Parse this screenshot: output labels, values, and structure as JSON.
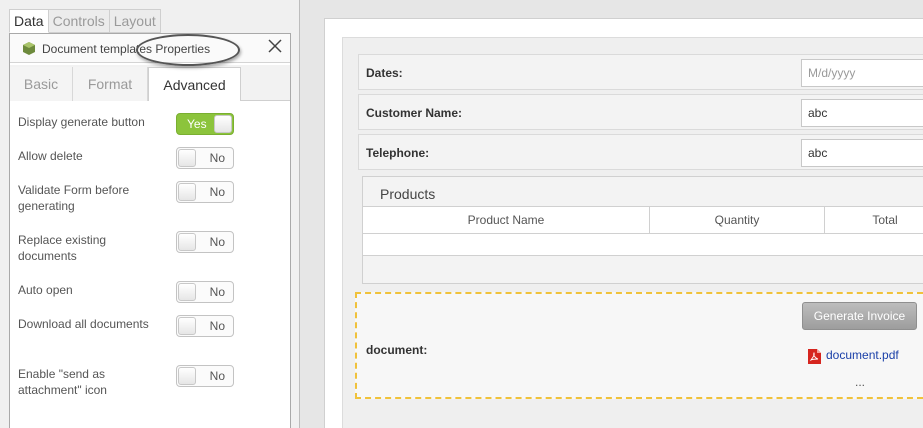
{
  "top_tabs": [
    "Data",
    "Controls",
    "Layout"
  ],
  "props_window": {
    "title": "Document templates Properties",
    "sub_tabs": [
      "Basic",
      "Format",
      "Advanced"
    ]
  },
  "properties": [
    {
      "label": "Display generate button",
      "toggle": "Yes",
      "on": true
    },
    {
      "label": "Allow delete",
      "toggle": "No",
      "on": false
    },
    {
      "label": "Validate Form before generating",
      "toggle": "No",
      "on": false
    },
    {
      "label": "Replace existing documents",
      "toggle": "No",
      "on": false
    },
    {
      "label": "Auto open",
      "toggle": "No",
      "on": false
    },
    {
      "label": "Download all documents",
      "toggle": "No",
      "on": false
    },
    {
      "label": "Enable \"send as attachment\" icon",
      "toggle": "No",
      "on": false
    }
  ],
  "form": {
    "fields": [
      {
        "label": "Dates:",
        "value": "",
        "placeholder": "M/d/yyyy"
      },
      {
        "label": "Customer Name:",
        "value": "abc",
        "placeholder": ""
      },
      {
        "label": "Telephone:",
        "value": "abc",
        "placeholder": ""
      }
    ],
    "products": {
      "title": "Products",
      "columns": [
        "Product Name",
        "Quantity",
        "Total"
      ]
    },
    "document": {
      "label": "document:",
      "button": "Generate Invoice",
      "file": "document.pdf",
      "more": "..."
    }
  },
  "colors": {
    "toggle_on": "#8cc43c",
    "link": "#1a3fa8",
    "highlight_border": "#f0c23b"
  }
}
